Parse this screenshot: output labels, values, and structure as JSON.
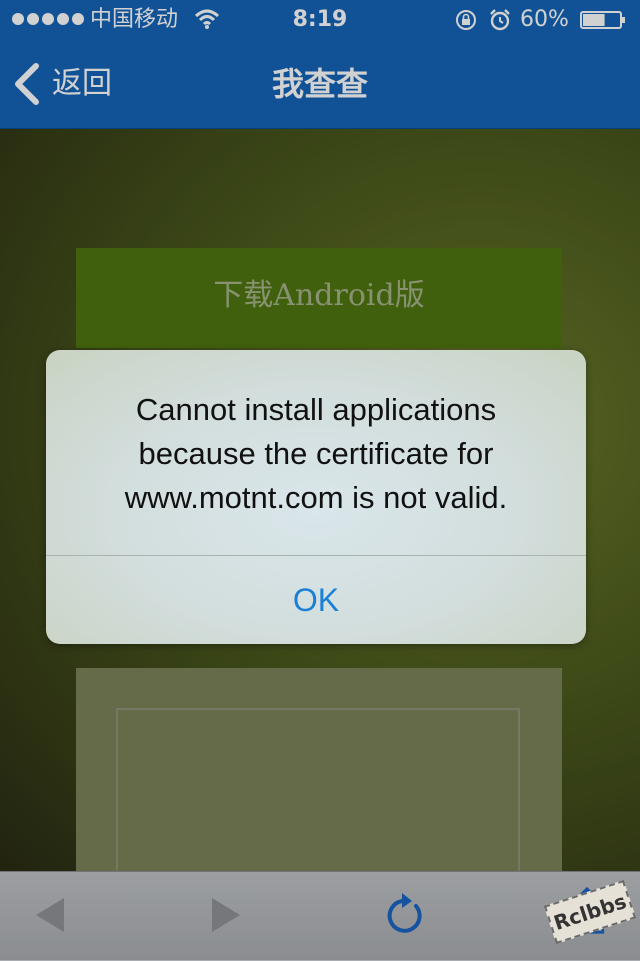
{
  "status_bar": {
    "carrier": "中国移动",
    "time": "8:19",
    "battery_percent": "60%",
    "battery_level": 0.6,
    "signal_icon": "signal-dots-icon",
    "wifi_icon": "wifi-icon",
    "lock_icon": "rotation-lock-icon",
    "alarm_icon": "alarm-icon"
  },
  "nav_bar": {
    "back_label": "返回",
    "title": "我查查",
    "back_icon": "chevron-left-icon"
  },
  "web_content": {
    "download_label": "下载Android版"
  },
  "alert": {
    "message_line1": "Cannot install applications",
    "message_line2": "because the certificate for",
    "message_line3": "www.motnt.com is not valid.",
    "ok_label": "OK"
  },
  "toolbar": {
    "back_icon": "arrow-left-icon",
    "forward_icon": "arrow-right-icon",
    "reload_icon": "reload-icon",
    "share_icon": "share-icon"
  },
  "watermark": {
    "text": "Rclbbs"
  },
  "colors": {
    "nav_blue": "#1565b8",
    "alert_button_blue": "#1a7fd6",
    "banner_green": "#4f7611"
  }
}
